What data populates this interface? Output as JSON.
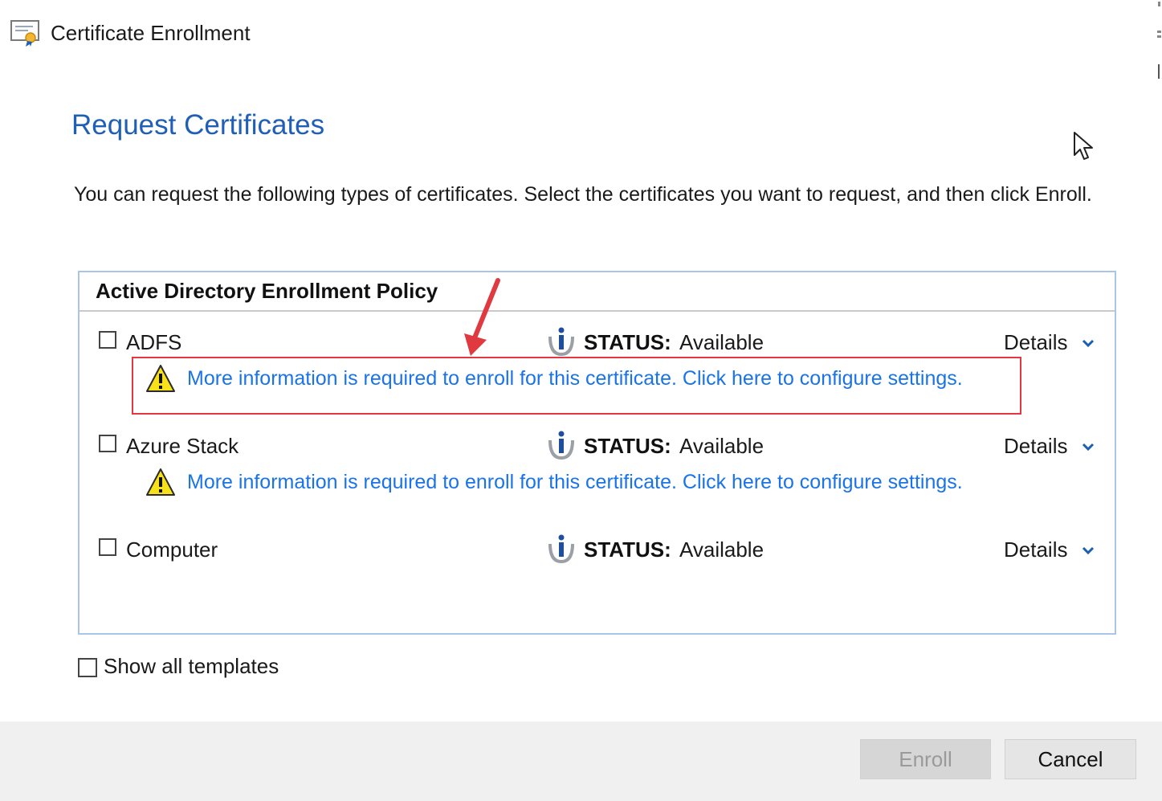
{
  "window": {
    "title": "Certificate Enrollment",
    "app_icon": "certificate-icon"
  },
  "page": {
    "title": "Request Certificates",
    "instructions": "You can request the following types of certificates. Select the certificates you want to request, and then click Enroll."
  },
  "policy": {
    "header": "Active Directory Enrollment Policy",
    "items": [
      {
        "name": "ADFS",
        "checked": false,
        "status_label": "STATUS:",
        "status_value": "Available",
        "details_label": "Details",
        "warning": "More information is required to enroll for this certificate. Click here to configure settings.",
        "highlighted": true
      },
      {
        "name": "Azure Stack",
        "checked": false,
        "status_label": "STATUS:",
        "status_value": "Available",
        "details_label": "Details",
        "warning": "More information is required to enroll for this certificate. Click here to configure settings.",
        "highlighted": false
      },
      {
        "name": "Computer",
        "checked": false,
        "status_label": "STATUS:",
        "status_value": "Available",
        "details_label": "Details",
        "warning": "",
        "highlighted": false
      }
    ]
  },
  "options": {
    "show_all_templates_label": "Show all templates",
    "show_all_templates_checked": false
  },
  "footer": {
    "enroll_label": "Enroll",
    "enroll_enabled": false,
    "cancel_label": "Cancel"
  },
  "colors": {
    "title_blue": "#1f5fb8",
    "link_blue": "#1a73e8",
    "highlight_red": "#e0393f",
    "policy_border": "#a9c6e8"
  }
}
